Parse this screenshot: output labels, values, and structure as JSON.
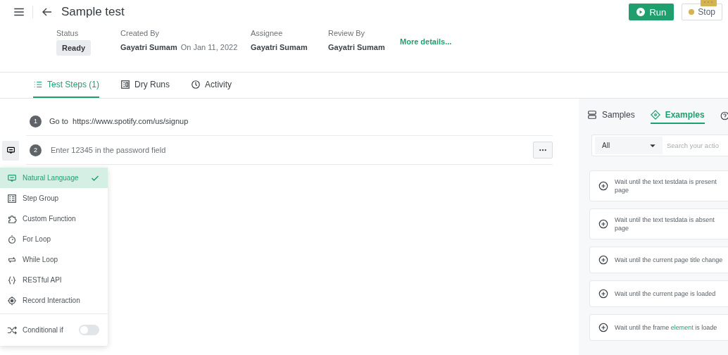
{
  "header": {
    "title": "Sample test",
    "run_label": "Run",
    "stop_label": "Stop"
  },
  "meta": [
    {
      "label": "Status",
      "value": "Ready",
      "kind": "badge"
    },
    {
      "label": "Created By",
      "value": "Gayatri Sumam",
      "extra": "On Jan 11, 2022",
      "kind": "text"
    },
    {
      "label": "Assignee",
      "value": "Gayatri Sumam",
      "kind": "text"
    },
    {
      "label": "Review By",
      "value": "Gayatri Sumam",
      "kind": "text"
    }
  ],
  "more_link": "More details...",
  "tabs": [
    {
      "label": "Test Steps (1)",
      "selected": true
    },
    {
      "label": "Dry Runs",
      "selected": false
    },
    {
      "label": "Activity",
      "selected": false
    }
  ],
  "steps": [
    {
      "number": "1",
      "editing": false,
      "action": "Go to",
      "target": "https://www.spotify.com/us/signup"
    },
    {
      "number": "2",
      "editing": true,
      "value": "Enter 12345 in the password field"
    }
  ],
  "step_type_menu": {
    "items": [
      {
        "label": "Natural Language",
        "selected": true
      },
      {
        "label": "Step Group",
        "selected": false
      },
      {
        "label": "Custom Function",
        "selected": false
      },
      {
        "label": "For Loop",
        "selected": false
      },
      {
        "label": "While Loop",
        "selected": false
      },
      {
        "label": "RESTful API",
        "selected": false
      },
      {
        "label": "Record Interaction",
        "selected": false
      }
    ],
    "toggle": {
      "label": "Conditional if",
      "on": false
    }
  },
  "side_panel": {
    "tabs": [
      {
        "label": "Samples",
        "selected": false
      },
      {
        "label": "Examples",
        "selected": true
      }
    ],
    "filter": "All",
    "search": {
      "placeholder": "Search your actio"
    },
    "cards": [
      {
        "lines": [
          [
            {
              "text": "Wait until the text  testdata  is present"
            }
          ],
          [
            {
              "text": "page"
            }
          ]
        ]
      },
      {
        "lines": [
          [
            {
              "text": "Wait until the text  testdata  is absent"
            }
          ],
          [
            {
              "text": "page"
            }
          ]
        ]
      },
      {
        "lines": [
          [
            {
              "text": "Wait until the current page title change"
            }
          ]
        ]
      },
      {
        "lines": [
          [
            {
              "text": "Wait until the current page is loaded"
            }
          ]
        ]
      },
      {
        "lines": [
          [
            {
              "text": "Wait until the frame "
            },
            {
              "text": "element",
              "kind": "token"
            },
            {
              "text": " is loade"
            }
          ]
        ]
      }
    ]
  }
}
